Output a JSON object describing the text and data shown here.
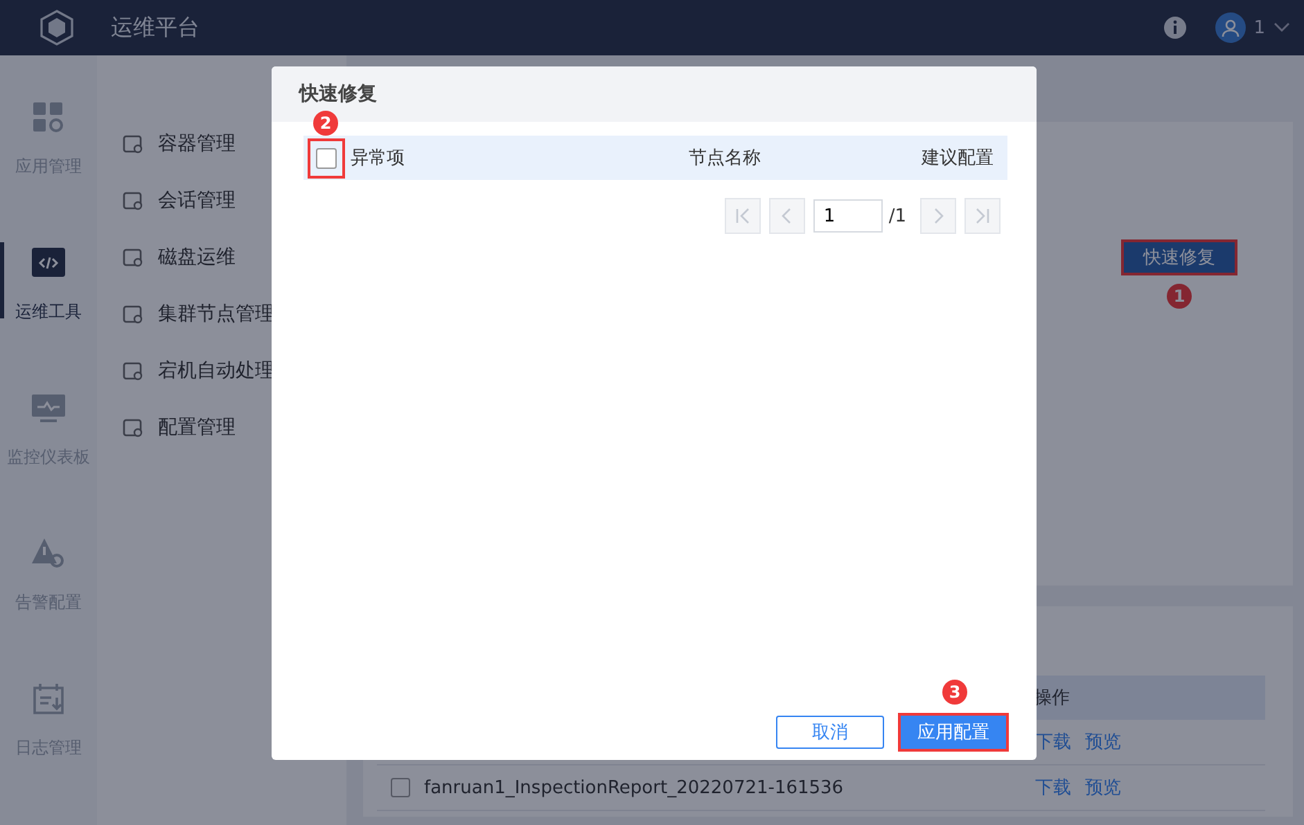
{
  "header": {
    "title": "运维平台",
    "user": "1"
  },
  "rail": [
    {
      "label": "应用管理",
      "selected": false
    },
    {
      "label": "运维工具",
      "selected": true
    },
    {
      "label": "监控仪表板",
      "selected": false
    },
    {
      "label": "告警配置",
      "selected": false
    },
    {
      "label": "日志管理",
      "selected": false
    }
  ],
  "submenu": [
    "容器管理",
    "会话管理",
    "磁盘运维",
    "集群节点管理",
    "宕机自动处理",
    "配置管理"
  ],
  "main": {
    "quick_fix_button": "快速修复",
    "quick_fix_badge": "1",
    "table": {
      "columns": [
        "操作"
      ],
      "rows": [
        {
          "actions": [
            "下载",
            "预览"
          ]
        },
        {
          "name": "fanruan1_InspectionReport_20220721-161536",
          "checked": false,
          "actions": [
            "下载",
            "预览"
          ]
        }
      ]
    }
  },
  "dialog": {
    "title": "快速修复",
    "columns": [
      "异常项",
      "节点名称",
      "建议配置"
    ],
    "select_all_checked": false,
    "select_badge": "2",
    "pager": {
      "page": "1",
      "total": "/1"
    },
    "buttons": [
      {
        "label": "取消",
        "kind": "secondary"
      },
      {
        "label": "应用配置",
        "kind": "primary",
        "badge": "3"
      }
    ]
  }
}
